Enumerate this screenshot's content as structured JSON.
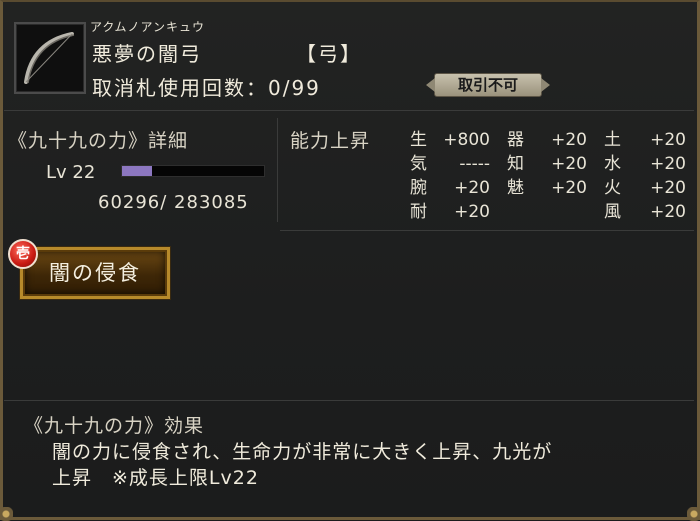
{
  "item": {
    "furigana": "アクムノアンキュウ",
    "name": "悪夢の闇弓",
    "type": "【弓】",
    "cancel_tag_label": "取消札使用回数：0/99",
    "trade_badge": "取引不可"
  },
  "detail": {
    "title": "《九十九の力》詳細",
    "level_label": "Lv 22",
    "exp_progress": 0.2116,
    "exp_text": "60296/  283085"
  },
  "ability": {
    "title": "能力上昇",
    "stats": [
      {
        "name": "生",
        "value": "+800"
      },
      {
        "name": "器",
        "value": "+20"
      },
      {
        "name": "土",
        "value": "+20"
      },
      {
        "name": "気",
        "value": "-----"
      },
      {
        "name": "知",
        "value": "+20"
      },
      {
        "name": "水",
        "value": "+20"
      },
      {
        "name": "腕",
        "value": "+20"
      },
      {
        "name": "魅",
        "value": "+20"
      },
      {
        "name": "火",
        "value": "+20"
      },
      {
        "name": "耐",
        "value": "+20"
      },
      {
        "name": "風",
        "value": "+20"
      }
    ]
  },
  "skill": {
    "badge": "壱",
    "label": "闇の侵食"
  },
  "effect": {
    "title": "《九十九の力》効果",
    "line1": "闇の力に侵食され、生命力が非常に大きく上昇、九光が",
    "line2": "上昇　※成長上限Lv22"
  },
  "colors": {
    "exp_bar": "#8c77c0",
    "skill_border": "#b78a2b",
    "badge_red": "#c81a12"
  }
}
